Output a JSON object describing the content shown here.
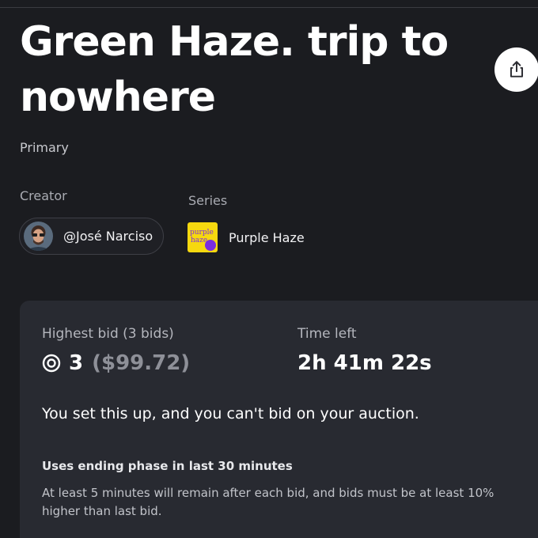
{
  "listing": {
    "title": "Green Haze. trip to nowhere",
    "edition": "Primary"
  },
  "creator": {
    "label": "Creator",
    "handle": "@José Narciso"
  },
  "series": {
    "label": "Series",
    "name": "Purple Haze",
    "thumb_text_1": "purple",
    "thumb_text_2": "haze"
  },
  "auction": {
    "highest_bid_label": "Highest bid (3 bids)",
    "bid_amount": "3",
    "bid_usd": "($99.72)",
    "time_left_label": "Time left",
    "time_left_value": "2h 41m 22s",
    "notice": "You set this up, and you can't bid on your auction.",
    "ending_phase_title": "Uses ending phase in last 30 minutes",
    "ending_phase_desc": "At least 5 minutes will remain after each bid, and bids must be at least 10% higher than last bid."
  },
  "icons": {
    "share": "share-icon",
    "currency": "coin-icon"
  },
  "colors": {
    "background": "#1b1c20",
    "card": "#282a31",
    "series_thumb": "#f6d80f",
    "series_dot": "#7a2de0"
  }
}
